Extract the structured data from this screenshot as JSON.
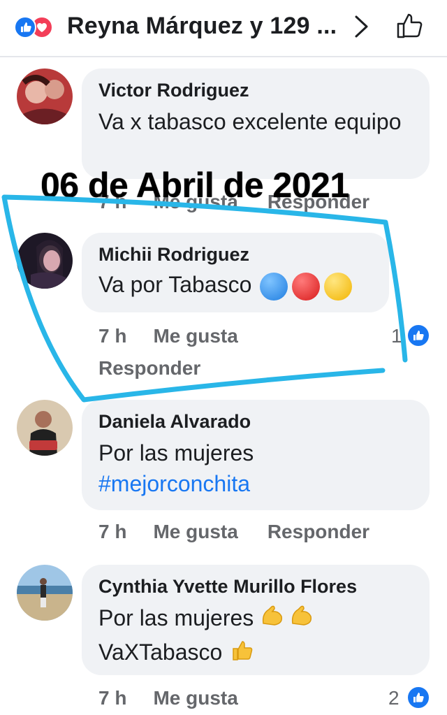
{
  "header": {
    "title": "Reyna Márquez y 129 ...",
    "icons": [
      "like-reaction-icon",
      "love-reaction-icon",
      "chevron-right-icon",
      "thumbs-up-icon"
    ]
  },
  "overlay": {
    "date": "06 de Abril de 2021",
    "highlight_color": "#29b6e8"
  },
  "comments": [
    {
      "author": "Victor Rodriguez",
      "text": "Va x tabasco excelente equipo",
      "actions": {
        "time": "7 h",
        "like": "Me gusta",
        "reply": "Responder"
      }
    },
    {
      "author": "Michii Rodriguez",
      "text": "Va por Tabasco",
      "emoji": [
        "blue-circle",
        "red-circle",
        "yellow-circle"
      ],
      "actions": {
        "time": "7 h",
        "like": "Me gusta",
        "reply": "Responder"
      },
      "like_count": "1"
    },
    {
      "author": "Daniela Alvarado",
      "text": "Por las mujeres",
      "hashtag": "#mejorconchita",
      "actions": {
        "time": "7 h",
        "like": "Me gusta",
        "reply": "Responder"
      }
    },
    {
      "author": "Cynthia Yvette Murillo Flores",
      "text_line1": "Por las mujeres",
      "text_line2": "VaXTabasco",
      "emoji": [
        "flexed-biceps",
        "flexed-biceps",
        "thumbs-up"
      ],
      "actions": {
        "time": "7 h",
        "like": "Me gusta"
      },
      "like_count": "2"
    }
  ],
  "colors": {
    "facebook_blue": "#1877f2",
    "love_red": "#f33e58",
    "bubble_bg": "#f0f2f5",
    "meta_gray": "#65676b"
  }
}
